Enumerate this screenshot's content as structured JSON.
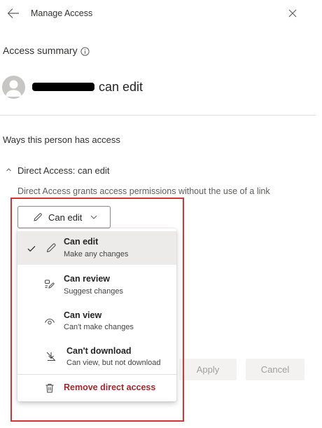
{
  "header": {
    "title": "Manage Access"
  },
  "summary": {
    "title": "Access summary",
    "access_level": "can edit"
  },
  "ways": {
    "title": "Ways this person has access",
    "direct_title": "Direct Access: can edit",
    "direct_description": "Direct Access grants access permissions without the use of a link"
  },
  "dropdown": {
    "selected_label": "Can edit",
    "items": [
      {
        "label": "Can edit",
        "sublabel": "Make any changes",
        "icon": "pencil-icon",
        "selected": true
      },
      {
        "label": "Can review",
        "sublabel": "Suggest changes",
        "icon": "review-icon",
        "selected": false
      },
      {
        "label": "Can view",
        "sublabel": "Can't make changes",
        "icon": "eye-icon",
        "selected": false
      },
      {
        "label": "Can't download",
        "sublabel": "Can view, but not download",
        "icon": "no-download-icon",
        "selected": false
      }
    ],
    "remove_label": "Remove direct access"
  },
  "buttons": {
    "apply": "Apply",
    "cancel": "Cancel"
  },
  "colors": {
    "remove": "#a4262c",
    "highlight_box": "#d13438",
    "selected_item_bg": "#edebe9"
  }
}
